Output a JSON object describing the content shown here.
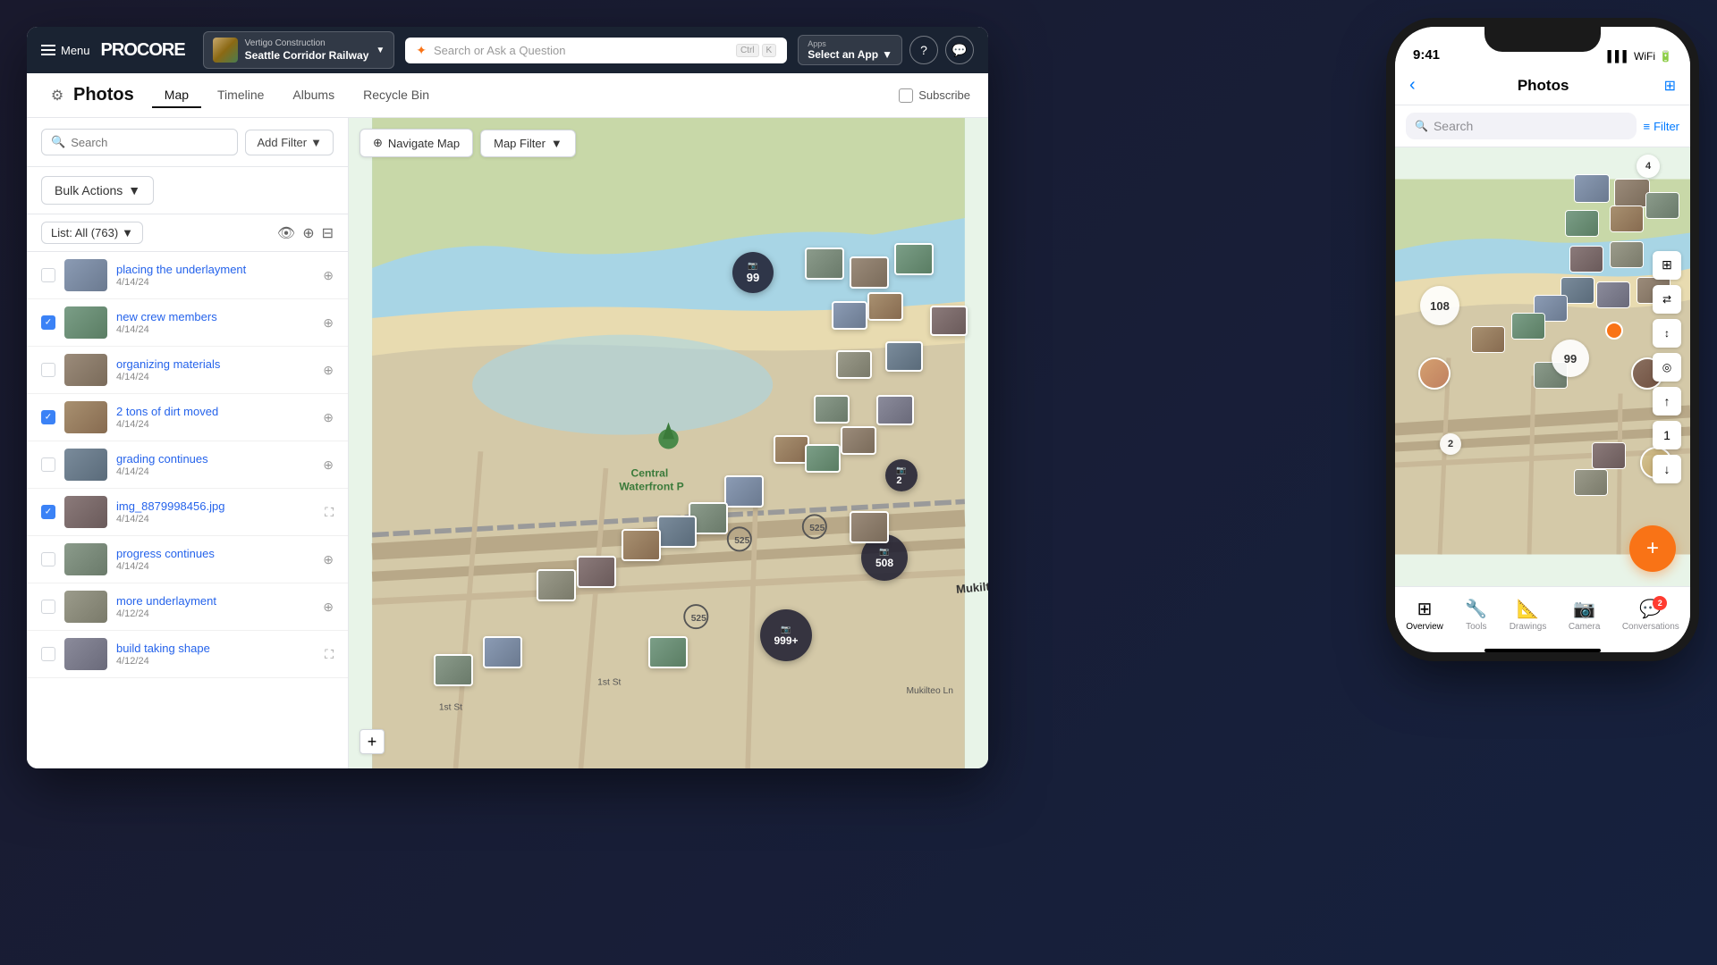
{
  "app": {
    "title": "Procore",
    "logo": "PROCORE"
  },
  "nav": {
    "menu_label": "Menu",
    "project": {
      "company": "Vertigo Construction",
      "name": "Seattle Corridor Railway"
    },
    "search": {
      "placeholder": "Search or Ask a Question",
      "shortcut_ctrl": "Ctrl",
      "shortcut_key": "K"
    },
    "apps": {
      "label": "Apps",
      "select_text": "Select an App"
    }
  },
  "page": {
    "title": "Photos",
    "tabs": [
      {
        "label": "Map",
        "active": true
      },
      {
        "label": "Timeline",
        "active": false
      },
      {
        "label": "Albums",
        "active": false
      },
      {
        "label": "Recycle Bin",
        "active": false
      }
    ],
    "subscribe_label": "Subscribe"
  },
  "filters": {
    "search_placeholder": "Search",
    "add_filter_label": "Add Filter",
    "bulk_actions_label": "Bulk Actions",
    "list_selector": "List: All (763)",
    "list_count": 763
  },
  "photos": [
    {
      "id": 1,
      "title": "placing the underlayment",
      "date": "4/14/24",
      "checked": false,
      "color": "#8B9BB4"
    },
    {
      "id": 2,
      "title": "new crew members",
      "date": "4/14/24",
      "checked": true,
      "color": "#7B9E87"
    },
    {
      "id": 3,
      "title": "organizing materials",
      "date": "4/14/24",
      "checked": false,
      "color": "#9B8B7A"
    },
    {
      "id": 4,
      "title": "2 tons of dirt moved",
      "date": "4/14/24",
      "checked": true,
      "color": "#A89070"
    },
    {
      "id": 5,
      "title": "grading continues",
      "date": "4/14/24",
      "checked": false,
      "color": "#7A8B9B"
    },
    {
      "id": 6,
      "title": "img_8879998456.jpg",
      "date": "4/14/24",
      "checked": true,
      "color": "#8B7A7A"
    },
    {
      "id": 7,
      "title": "progress continues",
      "date": "4/14/24",
      "checked": false,
      "color": "#8B9B8B"
    },
    {
      "id": 8,
      "title": "more underlayment",
      "date": "4/12/24",
      "checked": false,
      "color": "#9B9B8B"
    },
    {
      "id": 9,
      "title": "build taking shape",
      "date": "4/12/24",
      "checked": false,
      "color": "#8B8B9B"
    }
  ],
  "map": {
    "navigate_btn": "Navigate Map",
    "filter_btn": "Map Filter",
    "clusters": [
      {
        "label": "999+",
        "size": "large"
      },
      {
        "label": "508"
      },
      {
        "label": "99"
      },
      {
        "label": "2"
      }
    ],
    "zoom_plus": "+"
  },
  "mobile": {
    "time": "9:41",
    "title": "Photos",
    "search_placeholder": "Search",
    "filter_label": "Filter",
    "bottom_nav": [
      {
        "label": "Overview",
        "icon": "⊞",
        "active": true,
        "badge": null
      },
      {
        "label": "Tools",
        "icon": "🔧",
        "active": false,
        "badge": null
      },
      {
        "label": "Drawings",
        "icon": "📐",
        "active": false,
        "badge": null
      },
      {
        "label": "Camera",
        "icon": "📷",
        "active": false,
        "badge": null
      },
      {
        "label": "Conversations",
        "icon": "💬",
        "active": false,
        "badge": "2"
      }
    ],
    "fab_icon": "+",
    "map_controls": [
      "⊞",
      "⇄",
      "↕",
      "◎",
      "↑",
      "1",
      "↓"
    ]
  }
}
